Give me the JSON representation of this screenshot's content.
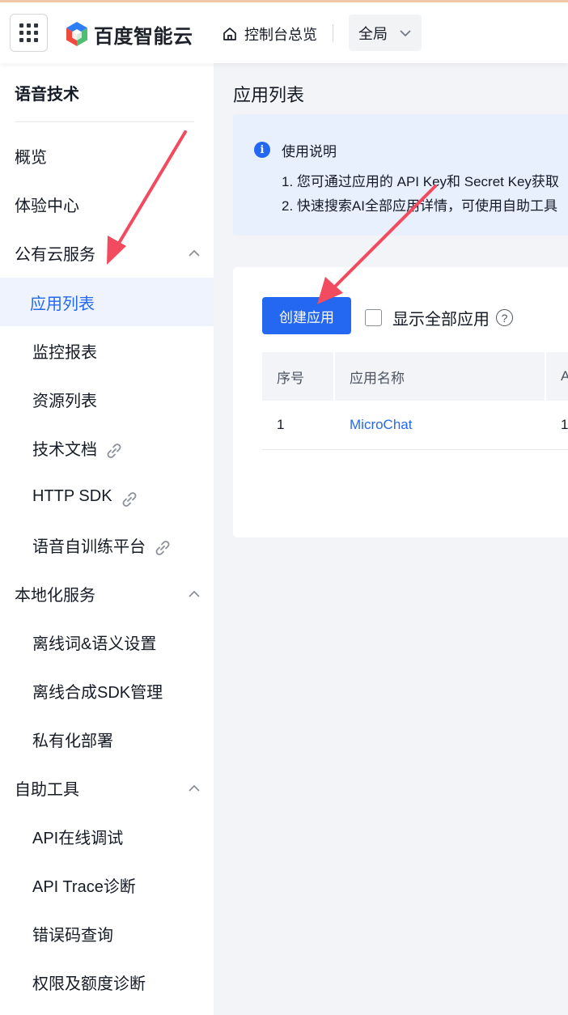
{
  "header": {
    "logo_text": "百度智能云",
    "overview_label": "控制台总览",
    "region_label": "全局"
  },
  "sidebar": {
    "title": "语音技术",
    "items": [
      {
        "label": "概览"
      },
      {
        "label": "体验中心"
      },
      {
        "label": "公有云服务"
      },
      {
        "label": "应用列表"
      },
      {
        "label": "监控报表"
      },
      {
        "label": "资源列表"
      },
      {
        "label": "技术文档"
      },
      {
        "label": "HTTP SDK"
      },
      {
        "label": "语音自训练平台"
      },
      {
        "label": "本地化服务"
      },
      {
        "label": "离线词&语义设置"
      },
      {
        "label": "离线合成SDK管理"
      },
      {
        "label": "私有化部署"
      },
      {
        "label": "自助工具"
      },
      {
        "label": "API在线调试"
      },
      {
        "label": "API Trace诊断"
      },
      {
        "label": "错误码查询"
      },
      {
        "label": "权限及额度诊断"
      }
    ]
  },
  "main": {
    "page_title": "应用列表",
    "notice": {
      "title": "使用说明",
      "line1": "1. 您可通过应用的 API Key和 Secret Key获取",
      "line2": "2. 快速搜索AI全部应用详情，可使用自助工具"
    },
    "create_button": "创建应用",
    "show_all_label": "显示全部应用",
    "help_glyph": "?",
    "table": {
      "headers": [
        "序号",
        "应用名称",
        "A"
      ],
      "rows": [
        {
          "index": "1",
          "name": "MicroChat",
          "col3": "1"
        }
      ]
    }
  },
  "colors": {
    "accent": "#2468f2",
    "annotation_arrow": "#f24a5e",
    "notice_bg": "#e8effd",
    "active_nav_bg": "#eef3fe"
  },
  "icons": {
    "apps_grid": "grid-icon",
    "home": "home-icon",
    "chevron": "chevron-down-icon",
    "link": "link-icon",
    "info": "info-icon",
    "help": "help-icon"
  }
}
